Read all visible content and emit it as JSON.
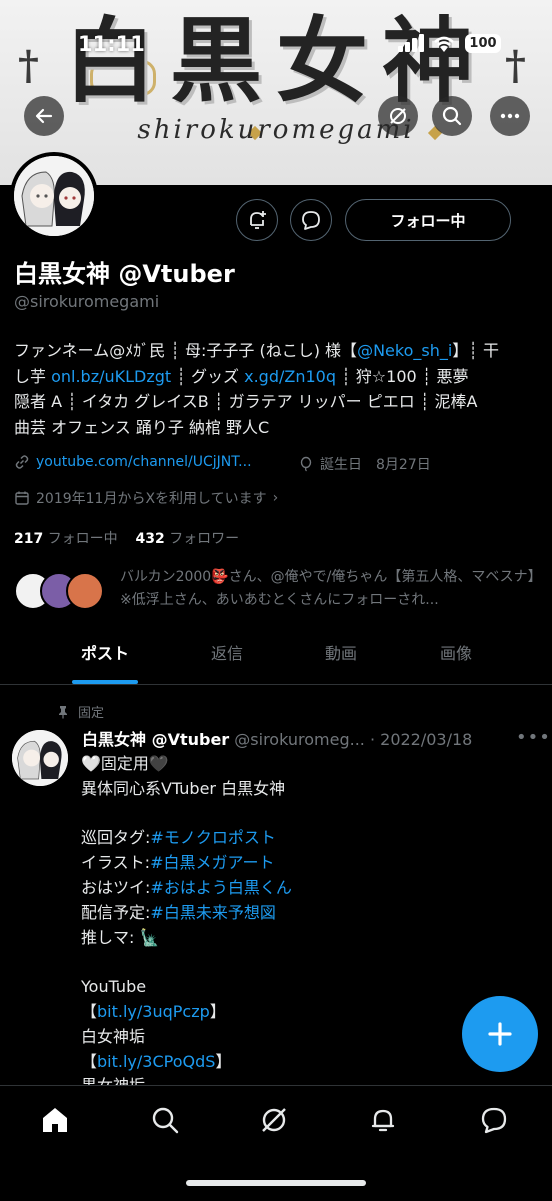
{
  "status_bar": {
    "time": "11:11",
    "battery": "100"
  },
  "banner": {
    "title": "白黒女神",
    "subtitle": "shirokuromegami"
  },
  "actions": {
    "follow_label": "フォロー中"
  },
  "profile": {
    "name": "白黒女神 @Vtuber",
    "handle": "@sirokuromegami",
    "bio_lines": [
      [
        {
          "t": "ファンネーム@ﾒｶﾞ民 ┊ 母:子子子 (ねこし) 様【",
          "blue": false
        },
        {
          "t": "@Neko_sh_i",
          "blue": true
        },
        {
          "t": "】┊ 干",
          "blue": false
        }
      ],
      [
        {
          "t": "し芋 ",
          "blue": false
        },
        {
          "t": "onl.bz/uKLDzgt",
          "blue": true
        },
        {
          "t": " ┊ グッズ ",
          "blue": false
        },
        {
          "t": "x.gd/Zn10q",
          "blue": true
        },
        {
          "t": " ┊ 狩☆100 ┊ 悪夢",
          "blue": false
        }
      ],
      [
        {
          "t": "隠者 A ┊ イタカ グレイスB ┊ ガラテア リッパー ピエロ ┊ 泥棒A",
          "blue": false
        }
      ],
      [
        {
          "t": "曲芸 オフェンス 踊り子 納棺 野人C",
          "blue": false
        }
      ]
    ],
    "link": "youtube.com/channel/UCjJNT...",
    "birthday": "誕生日　8月27日",
    "joined": "2019年11月からXを利用しています",
    "following_count": "217",
    "following_label": "フォロー中",
    "followers_count": "432",
    "followers_label": "フォロワー",
    "followed_by": "バルカン2000👺さん、@俺やで/俺ちゃん【第五人格、マベスナ】※低浮上さん、あいあむとくさんにフォローされ..."
  },
  "tabs": [
    "ポスト",
    "返信",
    "動画",
    "画像"
  ],
  "post": {
    "pinned_label": "固定",
    "author_name": "白黒女神 @Vtuber",
    "author_handle": "@sirokuromeg...",
    "date": "· 2022/03/18",
    "lines": [
      [
        {
          "t": "🤍固定用🖤",
          "blue": false
        }
      ],
      [
        {
          "t": "異体同心系VTuber 白黒女神",
          "blue": false
        }
      ],
      [],
      [
        {
          "t": "巡回タグ:",
          "blue": false
        },
        {
          "t": "#モノクロポスト",
          "blue": true
        }
      ],
      [
        {
          "t": "イラスト:",
          "blue": false
        },
        {
          "t": "#白黒メガアート",
          "blue": true
        }
      ],
      [
        {
          "t": "おはツイ:",
          "blue": false
        },
        {
          "t": "#おはよう白黒くん",
          "blue": true
        }
      ],
      [
        {
          "t": "配信予定:",
          "blue": false
        },
        {
          "t": "#白黒未来予想図",
          "blue": true
        }
      ],
      [
        {
          "t": "推しマ: 🗽",
          "blue": false
        }
      ],
      [],
      [
        {
          "t": "YouTube",
          "blue": false
        }
      ],
      [
        {
          "t": "【",
          "blue": false
        },
        {
          "t": "bit.ly/3uqPczp",
          "blue": true
        },
        {
          "t": "】",
          "blue": false
        }
      ],
      [
        {
          "t": "白女神垢",
          "blue": false
        }
      ],
      [
        {
          "t": "【",
          "blue": false
        },
        {
          "t": "bit.ly/3CPoQdS",
          "blue": true
        },
        {
          "t": "】",
          "blue": false
        }
      ],
      [
        {
          "t": "黒女神垢",
          "blue": false
        }
      ]
    ]
  },
  "colors": {
    "accent": "#1d9bf0",
    "muted": "#71767b",
    "background": "#000000"
  }
}
